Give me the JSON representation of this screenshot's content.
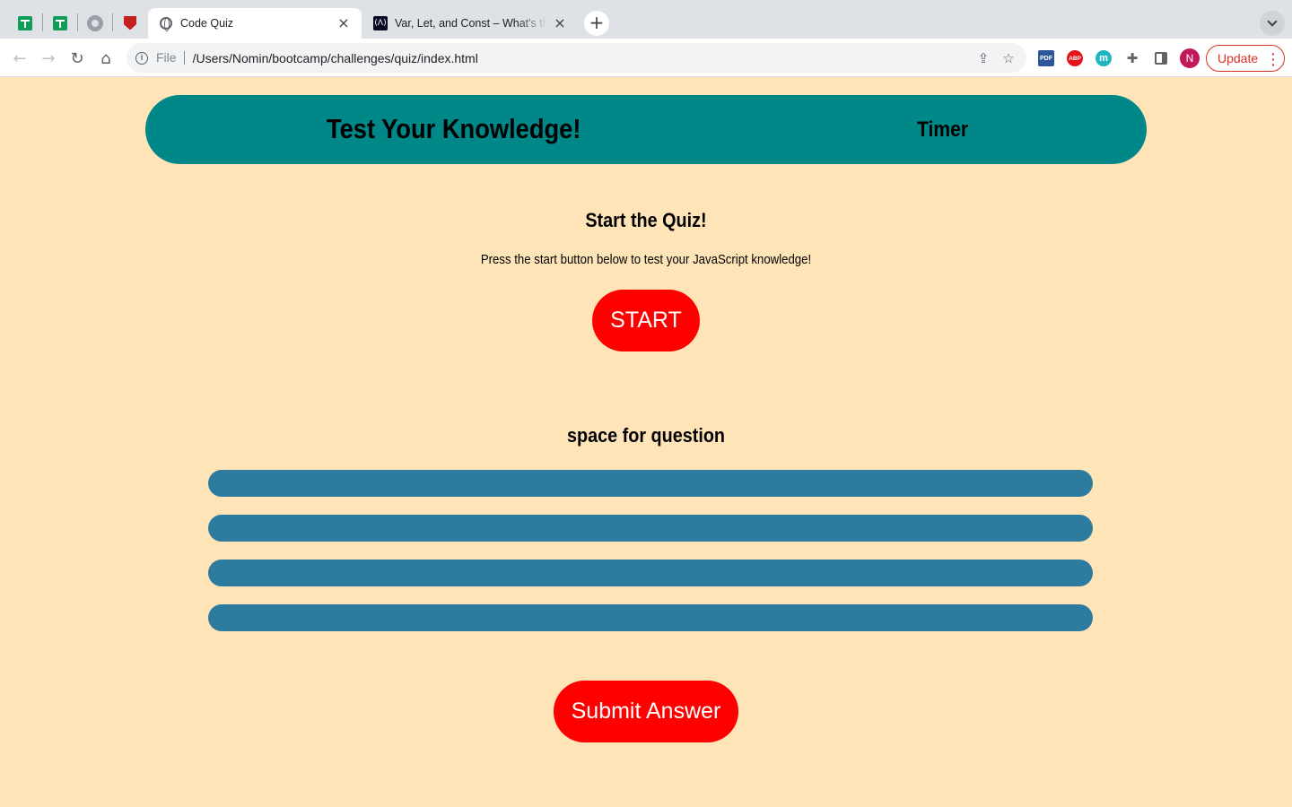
{
  "browser": {
    "tabs": [
      {
        "title": "Code Quiz",
        "active": true,
        "favicon": "globe-icon"
      },
      {
        "title": "Var, Let, and Const – What's the Difference?",
        "active": false,
        "favicon": "freecodecamp-icon"
      }
    ],
    "pinned_tabs": [
      "google-sheets-icon",
      "google-sheets-icon",
      "github-icon",
      "shield-icon"
    ],
    "address": {
      "chip": "File",
      "url": "/Users/Nomin/bootcamp/challenges/quiz/index.html"
    },
    "extensions": {
      "pdf": "PDF",
      "abp": "ABP",
      "m": "m"
    },
    "profile_initial": "N",
    "update_label": "Update",
    "new_tab_glyph": "+",
    "close_glyph": "×"
  },
  "page": {
    "header": {
      "title": "Test Your Knowledge!",
      "timer": "Timer"
    },
    "start": {
      "heading": "Start the Quiz!",
      "description": "Press the start button below to test your JavaScript knowledge!",
      "button": "START"
    },
    "question": {
      "text": "space for question",
      "answers": [
        "",
        "",
        "",
        ""
      ]
    },
    "submit": "Submit Answer"
  },
  "colors": {
    "background": "#ffe4b8",
    "header": "#008787",
    "answer": "#2e7ba0",
    "button": "#ff0000"
  }
}
